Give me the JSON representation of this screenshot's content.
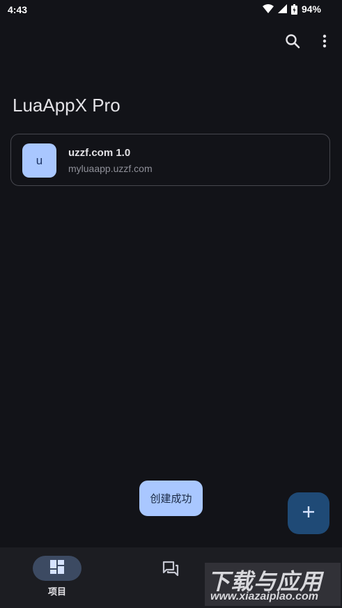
{
  "status_bar": {
    "time": "4:43",
    "battery": "94%",
    "icons": [
      "wifi-icon",
      "signal-icon",
      "battery-icon"
    ]
  },
  "toolbar": {
    "icons": [
      "search-icon",
      "more-vert-icon"
    ]
  },
  "page": {
    "title": "LuaAppX Pro"
  },
  "project": {
    "avatar_letter": "u",
    "name": "uzzf.com 1.0",
    "package": "myluaapp.uzzf.com"
  },
  "toast": {
    "text": "创建成功"
  },
  "fab": {
    "icon": "add-icon"
  },
  "bottom_nav": {
    "items": [
      {
        "label": "项目",
        "icon": "dashboard-icon",
        "selected": true
      },
      {
        "label": "",
        "icon": "forum-icon",
        "selected": false
      }
    ]
  },
  "watermark": {
    "title": "下载与应用",
    "url": "www.xiazaiplao.com"
  },
  "colors": {
    "background": "#121318",
    "accent": "#a9c7ff",
    "fab": "#1f4a76",
    "nav_bg": "#1c1d22"
  }
}
